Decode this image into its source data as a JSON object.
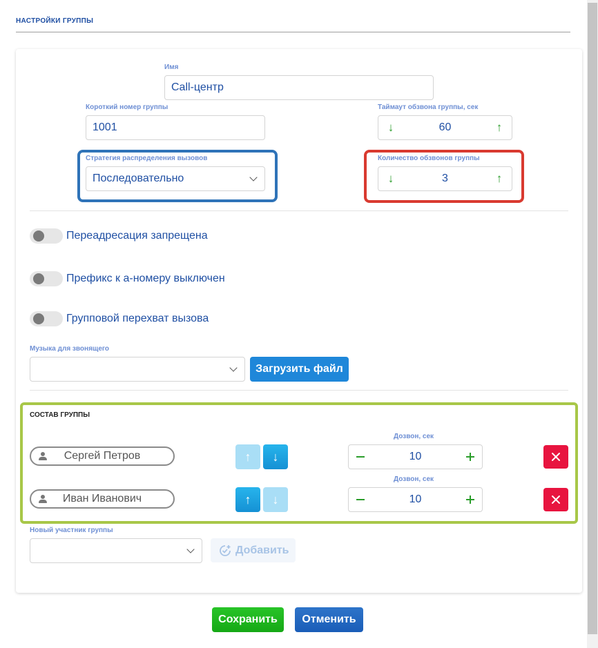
{
  "header": {
    "title": "НАСТРОЙКИ ГРУППЫ"
  },
  "form": {
    "name": {
      "label": "Имя",
      "value": "Call-центр"
    },
    "short_number": {
      "label": "Короткий номер группы",
      "value": "1001"
    },
    "timeout": {
      "label": "Таймаут обзвона группы, сек",
      "value": "60"
    },
    "strategy": {
      "label": "Стратегия распределения вызовов",
      "value": "Последовательно"
    },
    "call_count": {
      "label": "Количество обзвонов группы",
      "value": "3"
    }
  },
  "toggles": [
    {
      "label": "Переадресация запрещена",
      "on": false
    },
    {
      "label": "Префикс к а-номеру выключен",
      "on": false
    },
    {
      "label": "Групповой перехват вызова",
      "on": false
    }
  ],
  "music": {
    "label": "Музыка для звонящего",
    "value": "",
    "upload_label": "Загрузить файл"
  },
  "members_section": {
    "title": "СОСТАВ ГРУППЫ",
    "members": [
      {
        "name": "Сергей Петров",
        "dial_label": "Дозвон, сек",
        "dial_value": "10",
        "up_enabled": false,
        "down_enabled": true
      },
      {
        "name": "Иван Иванович",
        "dial_label": "Дозвон, сек",
        "dial_value": "10",
        "up_enabled": true,
        "down_enabled": false
      }
    ]
  },
  "new_member": {
    "label": "Новый участник группы",
    "value": "",
    "add_label": "Добавить"
  },
  "actions": {
    "save_label": "Сохранить",
    "cancel_label": "Отменить"
  },
  "colors": {
    "accent": "#1f4fa3",
    "save": "#1fb81f",
    "cancel": "#2166c0",
    "delete": "#e8143f",
    "step_arrow": "#2a9d2a"
  }
}
